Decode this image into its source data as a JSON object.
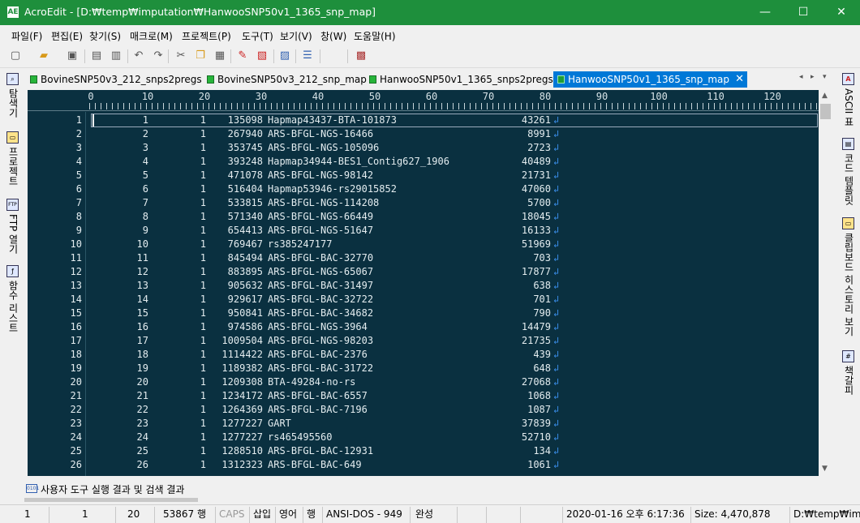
{
  "window": {
    "title": "AcroEdit - [D:₩temp₩imputation₩HanwooSNP50v1_1365_snp_map]",
    "app_icon": "AE",
    "minimize": "—",
    "maximize": "☐",
    "close": "✕"
  },
  "menu": [
    "파일(F)",
    "편집(E)",
    "찾기(S)",
    "매크로(M)",
    "프로젝트(P)",
    "도구(T)",
    "보기(V)",
    "창(W)",
    "도움말(H)"
  ],
  "toolbar_icons": [
    "new-file-icon",
    "open-folder-icon",
    "save-icon",
    "print-preview-icon",
    "print-icon",
    "undo-icon",
    "redo-icon",
    "cut-icon",
    "copy-icon",
    "paste-icon",
    "marker-icon",
    "bookmark-icon",
    "goto-icon",
    "list-icon",
    "blank-icon",
    "calendar-icon"
  ],
  "left_panels": [
    {
      "label": "탐색기",
      "icon": "explorer-icon"
    },
    {
      "label": "프로젝트",
      "icon": "project-icon"
    },
    {
      "label": "FTP 열기",
      "icon": "ftp-icon"
    },
    {
      "label": "함수 리스트",
      "icon": "function-list-icon"
    }
  ],
  "right_panels": [
    {
      "label": "ASCII 표",
      "icon": "ascii-icon"
    },
    {
      "label": "코드 템플릿",
      "icon": "code-template-icon"
    },
    {
      "label": "클립보드 히스토리 보기",
      "icon": "clipboard-history-icon"
    },
    {
      "label": "책갈피",
      "icon": "bookmark-panel-icon"
    }
  ],
  "tabs": [
    {
      "label": "BovineSNP50v3_212_snps2pregs",
      "active": false
    },
    {
      "label": "BovineSNP50v3_212_snp_map",
      "active": false
    },
    {
      "label": "HanwooSNP50v1_1365_snps2pregs",
      "active": false
    },
    {
      "label": "HanwooSNP50v1_1365_snp_map",
      "active": true,
      "close": "✕"
    }
  ],
  "tab_nav": {
    "prev": "◂",
    "next": "▸",
    "menu": "▾"
  },
  "ruler": [
    "0",
    "10",
    "20",
    "30",
    "40",
    "50",
    "60",
    "70",
    "80",
    "90",
    "100",
    "110",
    "120"
  ],
  "lines": [
    [
      "1",
      "1",
      "1",
      "135098",
      "Hapmap43437-BTA-101873",
      "43261"
    ],
    [
      "2",
      "2",
      "1",
      "267940",
      "ARS-BFGL-NGS-16466",
      "8991"
    ],
    [
      "3",
      "3",
      "1",
      "353745",
      "ARS-BFGL-NGS-105096",
      "2723"
    ],
    [
      "4",
      "4",
      "1",
      "393248",
      "Hapmap34944-BES1_Contig627_1906",
      "40489"
    ],
    [
      "5",
      "5",
      "1",
      "471078",
      "ARS-BFGL-NGS-98142",
      "21731"
    ],
    [
      "6",
      "6",
      "1",
      "516404",
      "Hapmap53946-rs29015852",
      "47060"
    ],
    [
      "7",
      "7",
      "1",
      "533815",
      "ARS-BFGL-NGS-114208",
      "5700"
    ],
    [
      "8",
      "8",
      "1",
      "571340",
      "ARS-BFGL-NGS-66449",
      "18045"
    ],
    [
      "9",
      "9",
      "1",
      "654413",
      "ARS-BFGL-NGS-51647",
      "16133"
    ],
    [
      "10",
      "10",
      "1",
      "769467",
      "rs385247177",
      "51969"
    ],
    [
      "11",
      "11",
      "1",
      "845494",
      "ARS-BFGL-BAC-32770",
      "703"
    ],
    [
      "12",
      "12",
      "1",
      "883895",
      "ARS-BFGL-NGS-65067",
      "17877"
    ],
    [
      "13",
      "13",
      "1",
      "905632",
      "ARS-BFGL-BAC-31497",
      "638"
    ],
    [
      "14",
      "14",
      "1",
      "929617",
      "ARS-BFGL-BAC-32722",
      "701"
    ],
    [
      "15",
      "15",
      "1",
      "950841",
      "ARS-BFGL-BAC-34682",
      "790"
    ],
    [
      "16",
      "16",
      "1",
      "974586",
      "ARS-BFGL-NGS-3964",
      "14479"
    ],
    [
      "17",
      "17",
      "1",
      "1009504",
      "ARS-BFGL-NGS-98203",
      "21735"
    ],
    [
      "18",
      "18",
      "1",
      "1114422",
      "ARS-BFGL-BAC-2376",
      "439"
    ],
    [
      "19",
      "19",
      "1",
      "1189382",
      "ARS-BFGL-BAC-31722",
      "648"
    ],
    [
      "20",
      "20",
      "1",
      "1209308",
      "BTA-49284-no-rs",
      "27068"
    ],
    [
      "21",
      "21",
      "1",
      "1234172",
      "ARS-BFGL-BAC-6557",
      "1068"
    ],
    [
      "22",
      "22",
      "1",
      "1264369",
      "ARS-BFGL-BAC-7196",
      "1087"
    ],
    [
      "23",
      "23",
      "1",
      "1277227",
      "GART",
      "37839"
    ],
    [
      "24",
      "24",
      "1",
      "1277227",
      "rs465495560",
      "52710"
    ],
    [
      "25",
      "25",
      "1",
      "1288510",
      "ARS-BFGL-BAC-12931",
      "134"
    ],
    [
      "26",
      "26",
      "1",
      "1312323",
      "ARS-BFGL-BAC-649",
      "1061"
    ]
  ],
  "eol_glyph": "↲",
  "output_panel": {
    "label": "사용자 도구 실행 결과 및 검색 결과",
    "icon": "output-icon",
    "icon_text": "0101"
  },
  "status": {
    "line": "1",
    "col": "1",
    "char": "20",
    "total": "53867 행",
    "caps": "CAPS",
    "insert": "삽입",
    "lang": "영어",
    "unit": "행",
    "encoding": "ANSI-DOS - 949",
    "complete": "완성",
    "datetime": "2020-01-16 오후 6:17:36",
    "size": "Size: 4,470,878",
    "path": "D:₩temp₩imp"
  }
}
